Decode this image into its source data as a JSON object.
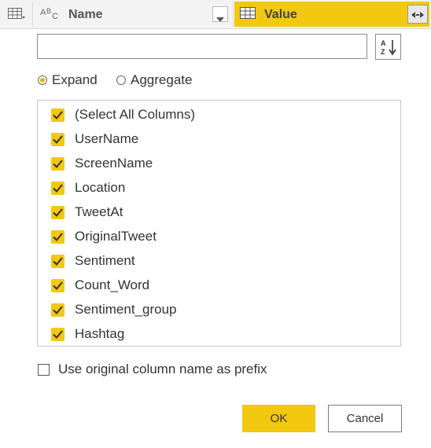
{
  "header": {
    "type_icon": "table-icon",
    "name_type_icon": "abc-text-type-icon",
    "name_label": "Name",
    "value_type_icon": "table-icon",
    "value_label": "Value",
    "expand_icon": "expand-columns-icon",
    "value_column_color": "#f2c811"
  },
  "search": {
    "value": "",
    "placeholder": ""
  },
  "sort_button_icon": "sort-ascending-icon",
  "mode": {
    "expand_label": "Expand",
    "aggregate_label": "Aggregate",
    "selected": "Expand"
  },
  "columns": [
    {
      "label": "(Select All Columns)",
      "checked": true
    },
    {
      "label": "UserName",
      "checked": true
    },
    {
      "label": "ScreenName",
      "checked": true
    },
    {
      "label": "Location",
      "checked": true
    },
    {
      "label": "TweetAt",
      "checked": true
    },
    {
      "label": "OriginalTweet",
      "checked": true
    },
    {
      "label": "Sentiment",
      "checked": true
    },
    {
      "label": "Count_Word",
      "checked": true
    },
    {
      "label": "Sentiment_group",
      "checked": true
    },
    {
      "label": "Hashtag",
      "checked": true
    }
  ],
  "prefix_option": {
    "label": "Use original column name as prefix",
    "checked": false
  },
  "buttons": {
    "ok_label": "OK",
    "cancel_label": "Cancel"
  },
  "accent_color": "#f2c811"
}
